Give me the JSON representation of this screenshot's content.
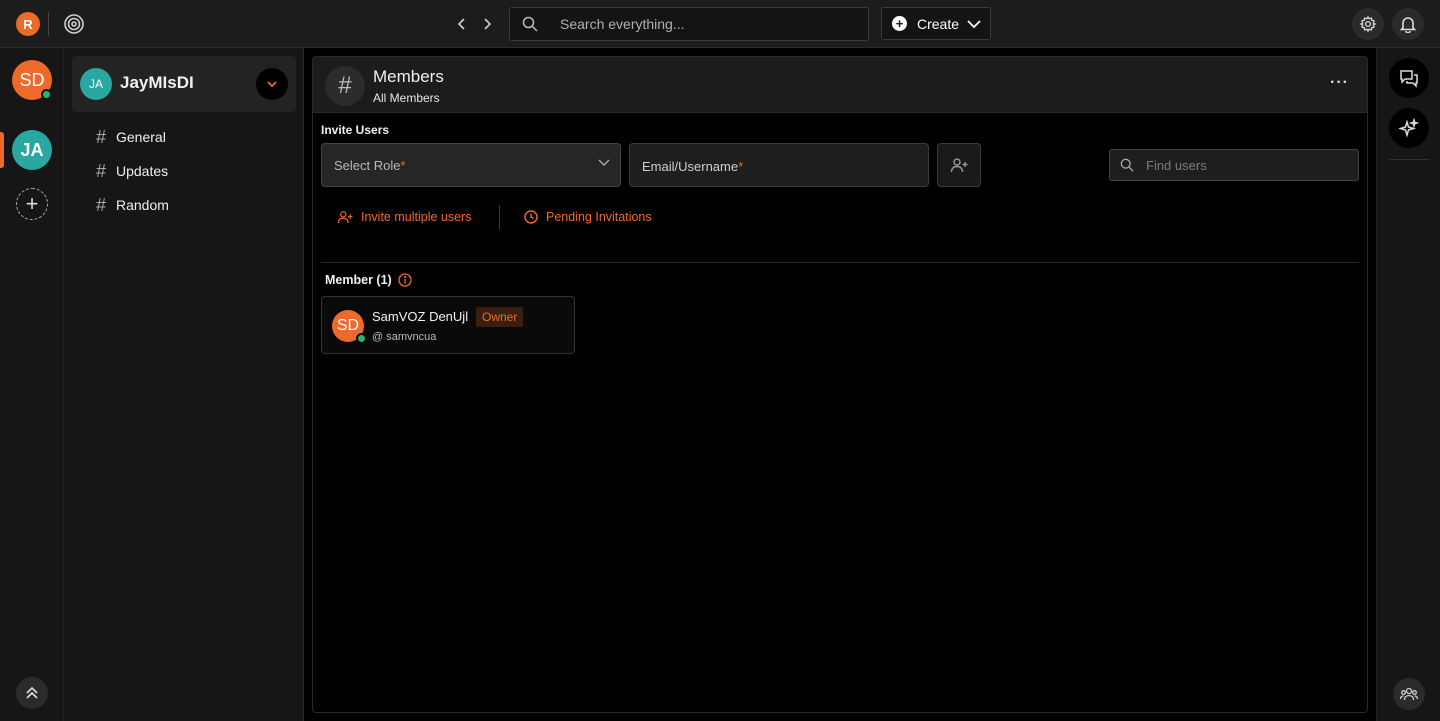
{
  "topbar": {
    "logo_letter": "R",
    "search_placeholder": "Search everything...",
    "create_label": "Create",
    "icons": [
      "radar-icon",
      "chevron-left-icon",
      "chevron-right-icon",
      "search-icon",
      "plus-icon",
      "chevron-down-icon",
      "gear-icon",
      "bell-icon"
    ]
  },
  "rail": {
    "user_initials": "SD",
    "workspace_initials": "JA",
    "add_label": "+",
    "icons": [
      "plus-icon",
      "chevrons-up-icon"
    ]
  },
  "sidebar": {
    "workspace_initials": "JA",
    "workspace_name": "JayMIsDI",
    "channels": [
      {
        "hash": "#",
        "label": "General"
      },
      {
        "hash": "#",
        "label": "Updates"
      },
      {
        "hash": "#",
        "label": "Random"
      }
    ]
  },
  "main": {
    "header_icon": "#",
    "title": "Members",
    "subtitle": "All Members",
    "more_label": "···",
    "invite_title": "Invite Users",
    "role_placeholder": "Select Role",
    "email_placeholder": "Email/Username",
    "required_mark": "*",
    "find_placeholder": "Find users",
    "invite_multiple_label": "Invite multiple users",
    "pending_invitations_label": "Pending Invitations",
    "member_heading": "Member (1)",
    "members": [
      {
        "initials": "SD",
        "name": "SamVOZ DenUjl",
        "role_badge": "Owner",
        "username": "@ samvncua"
      }
    ]
  },
  "colors": {
    "accent": "#ee6a2a",
    "online": "#2ab36a",
    "workspace": "#2aa7a0",
    "background": "#000000",
    "panel": "#1c1c1c"
  }
}
